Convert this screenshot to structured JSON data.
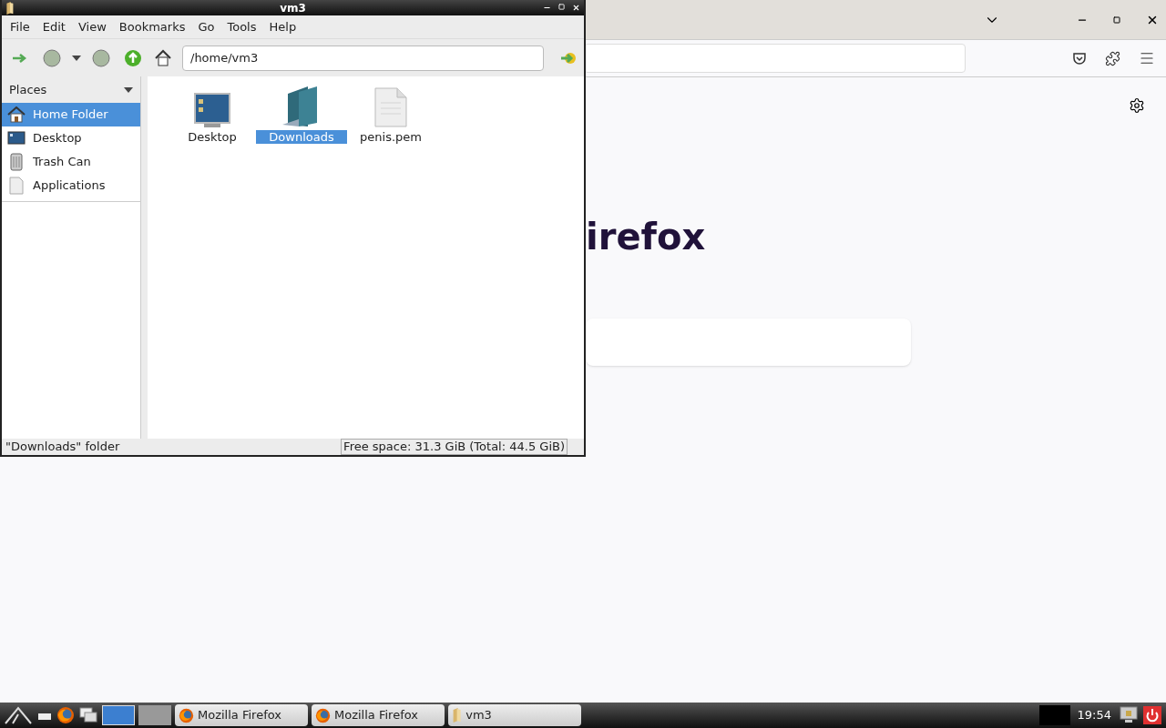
{
  "browser": {
    "heading": "irefox"
  },
  "file_manager": {
    "title": "vm3",
    "menu": [
      "File",
      "Edit",
      "View",
      "Bookmarks",
      "Go",
      "Tools",
      "Help"
    ],
    "location": "/home/vm3",
    "places": {
      "title": "Places",
      "items": [
        {
          "label": "Home Folder",
          "kind": "home",
          "selected": true
        },
        {
          "label": "Desktop",
          "kind": "desktop",
          "selected": false
        },
        {
          "label": "Trash Can",
          "kind": "trash",
          "selected": false
        },
        {
          "label": "Applications",
          "kind": "apps",
          "selected": false
        }
      ]
    },
    "files": [
      {
        "name": "Desktop",
        "kind": "desktop",
        "selected": false
      },
      {
        "name": "Downloads",
        "kind": "folder",
        "selected": true
      },
      {
        "name": "penis.pem",
        "kind": "file",
        "selected": false
      }
    ],
    "status": "\"Downloads\" folder",
    "free_space": "Free space: 31.3 GiB (Total: 44.5 GiB)"
  },
  "taskbar": {
    "tasks": [
      {
        "label": "Mozilla Firefox",
        "kind": "firefox",
        "selected": false
      },
      {
        "label": "Mozilla Firefox",
        "kind": "firefox",
        "selected": false
      },
      {
        "label": "vm3",
        "kind": "folder",
        "selected": false
      }
    ],
    "clock": "19:54"
  }
}
